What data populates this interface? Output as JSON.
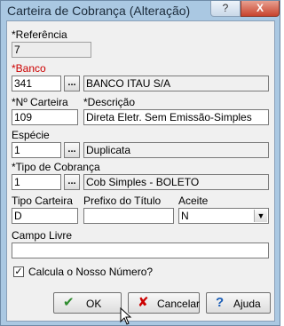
{
  "window": {
    "title": "Carteira de Cobrança (Alteração)",
    "help_button": "?",
    "close_button": "X"
  },
  "form": {
    "referencia": {
      "label": "*Referência",
      "value": "7"
    },
    "banco": {
      "label": "*Banco",
      "code": "341",
      "lookup": "...",
      "name": "BANCO ITAU S/A"
    },
    "carteira": {
      "label": "*Nº Carteira",
      "value": "109"
    },
    "descricao": {
      "label": "*Descrição",
      "value": "Direta Eletr. Sem Emissão-Simples"
    },
    "especie": {
      "label": "Espécie",
      "code": "1",
      "lookup": "...",
      "name": "Duplicata"
    },
    "tipo_cobranca": {
      "label": "*Tipo de Cobrança",
      "code": "1",
      "lookup": "...",
      "name": "Cob Simples - BOLETO"
    },
    "tipo_carteira": {
      "label": "Tipo Carteira",
      "value": "D"
    },
    "prefixo_titulo": {
      "label": "Prefixo do Título",
      "value": ""
    },
    "aceite": {
      "label": "Aceite",
      "value": "N"
    },
    "campo_livre": {
      "label": "Campo Livre",
      "value": ""
    },
    "calcula_nosso_numero": {
      "label": "Calcula o Nosso Número?",
      "checked": true
    }
  },
  "buttons": {
    "ok": "OK",
    "cancelar": "Cancelar",
    "ajuda": "Ajuda"
  },
  "colors": {
    "required_label": "#cc0000",
    "ok_icon": "#2e8b2e",
    "cancel_icon": "#cc0000",
    "help_icon": "#1c5fb8"
  },
  "icons": [
    "help-icon",
    "close-icon",
    "ellipsis-icon",
    "chevron-down-icon",
    "checkmark-icon",
    "x-icon",
    "question-icon"
  ]
}
